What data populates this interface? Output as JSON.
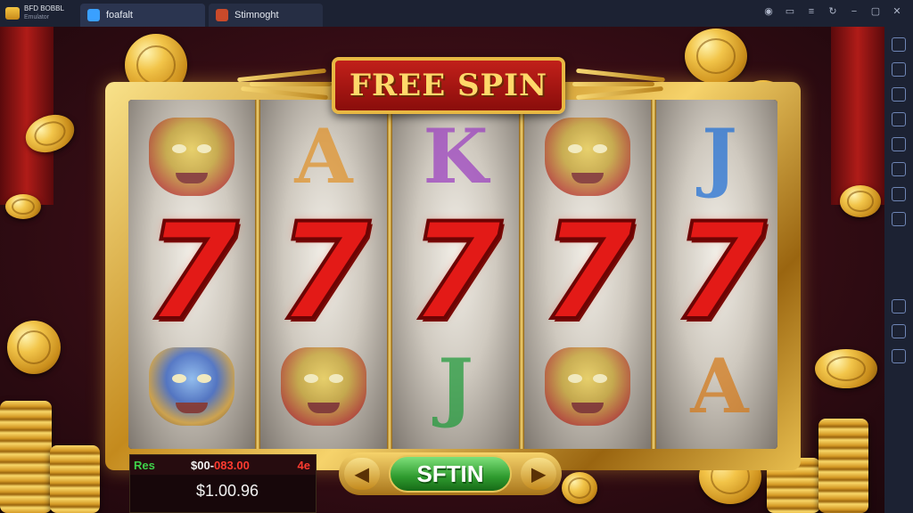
{
  "topbar": {
    "app_name": "BFD BOBBL",
    "app_sub": "Emulator",
    "tabs": [
      {
        "label": "foafalt"
      },
      {
        "label": "Stimnoght"
      }
    ]
  },
  "game": {
    "banner": "FREE SPIN",
    "reels": [
      {
        "top": "dragon-mask-red",
        "mid": "7",
        "bot": "lion-mask-blue"
      },
      {
        "top": "A",
        "mid": "7",
        "bot": "dragon-mask-red"
      },
      {
        "top": "K",
        "mid": "7",
        "bot": "J"
      },
      {
        "top": "dragon-mask-red",
        "mid": "7",
        "bot": "dragon-mask-red"
      },
      {
        "top": "J",
        "mid": "7",
        "bot": "A"
      }
    ],
    "bet_label": "Res",
    "bet_amount_prefix": "$00-",
    "bet_amount_red": "083.00",
    "bet_suffix": "4e",
    "balance": "$1.00.96",
    "spin_label": "SFTIN",
    "arrow_left": "◀",
    "arrow_right": "▶"
  },
  "colors": {
    "accent_gold": "#f2c54a",
    "seven_red": "#e31a17",
    "spin_green": "#2e9a2e",
    "banner_red": "#c1201a"
  }
}
